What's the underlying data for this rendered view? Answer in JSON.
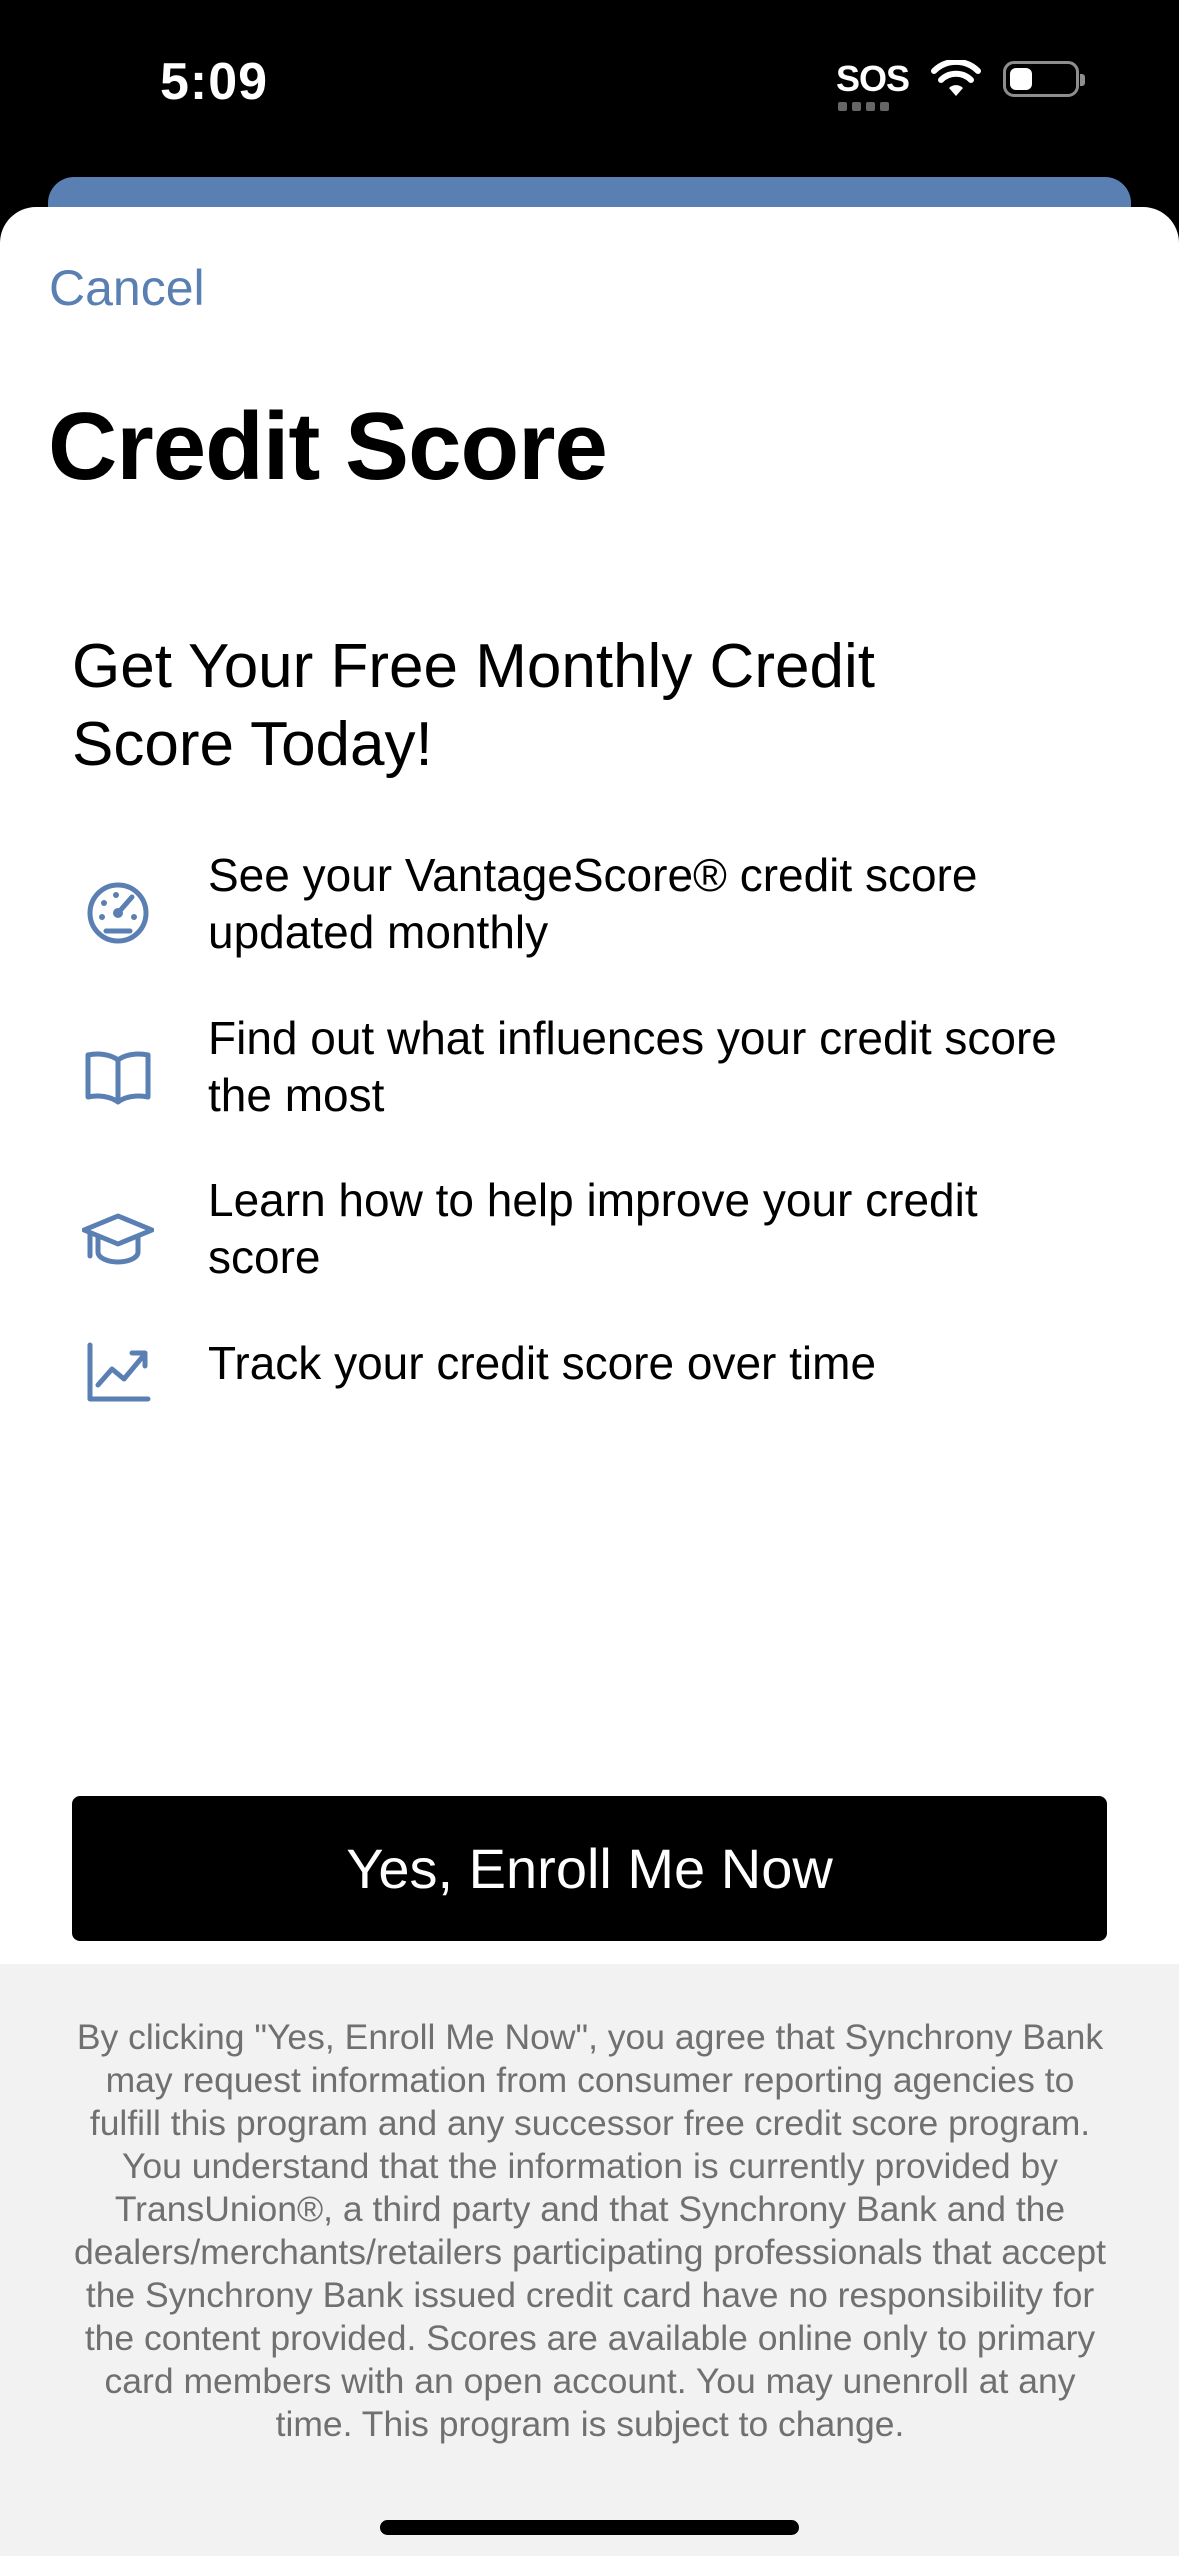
{
  "status_bar": {
    "time": "5:09",
    "sos_label": "SOS",
    "battery_level": 0.35
  },
  "sheet": {
    "cancel_label": "Cancel",
    "title": "Credit Score",
    "headline": "Get Your Free Monthly Credit Score Today!",
    "features": [
      {
        "icon": "gauge-icon",
        "text": "See your VantageScore® credit score updated monthly"
      },
      {
        "icon": "book-icon",
        "text": "Find out what influences your credit score the most"
      },
      {
        "icon": "graduation-cap-icon",
        "text": "Learn how to help improve your credit score"
      },
      {
        "icon": "chart-line-icon",
        "text": "Track your credit score over time"
      }
    ],
    "enroll_button_label": "Yes, Enroll Me Now",
    "disclaimer": "By clicking \"Yes, Enroll Me Now\", you agree that Synchrony Bank may request information from consumer reporting agencies to fulfill this program and any successor free credit score program. You understand that the information is currently provided by TransUnion®, a third party and that Synchrony Bank and the dealers/merchants/retailers participating professionals that accept the Synchrony Bank issued credit card have no responsibility for the content provided. Scores are available online only to primary card members with an open account. You may unenroll at any time. This program is subject to change."
  },
  "colors": {
    "accent": "#5a7fb3",
    "button_bg": "#000000",
    "disclaimer_bg": "#f2f2f2",
    "disclaimer_text": "#707070"
  }
}
